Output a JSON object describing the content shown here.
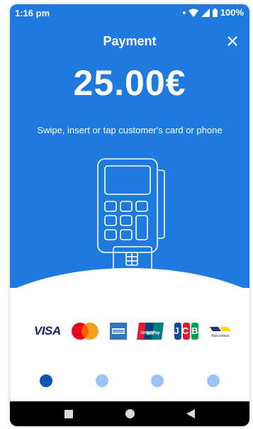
{
  "status_bar": {
    "time": "1:16 pm",
    "battery": "100%"
  },
  "header": {
    "title": "Payment",
    "close_icon": "close-icon"
  },
  "amount": "25.00€",
  "instruction": "Swipe, insert or tap customer's card or phone",
  "card_logos": {
    "visa": "VISA",
    "unionpay": "UnionPay",
    "unionpay_sub": "银联",
    "jcb": "JCB",
    "bancontact": "Bancontact"
  },
  "pager": {
    "count": 4,
    "active_index": 0
  },
  "colors": {
    "primary": "#1f7ae0",
    "dot_active": "#0a55b5",
    "dot_inactive": "#9bc4f7"
  },
  "nav_icons": [
    "square-recents-icon",
    "circle-home-icon",
    "triangle-back-icon"
  ]
}
